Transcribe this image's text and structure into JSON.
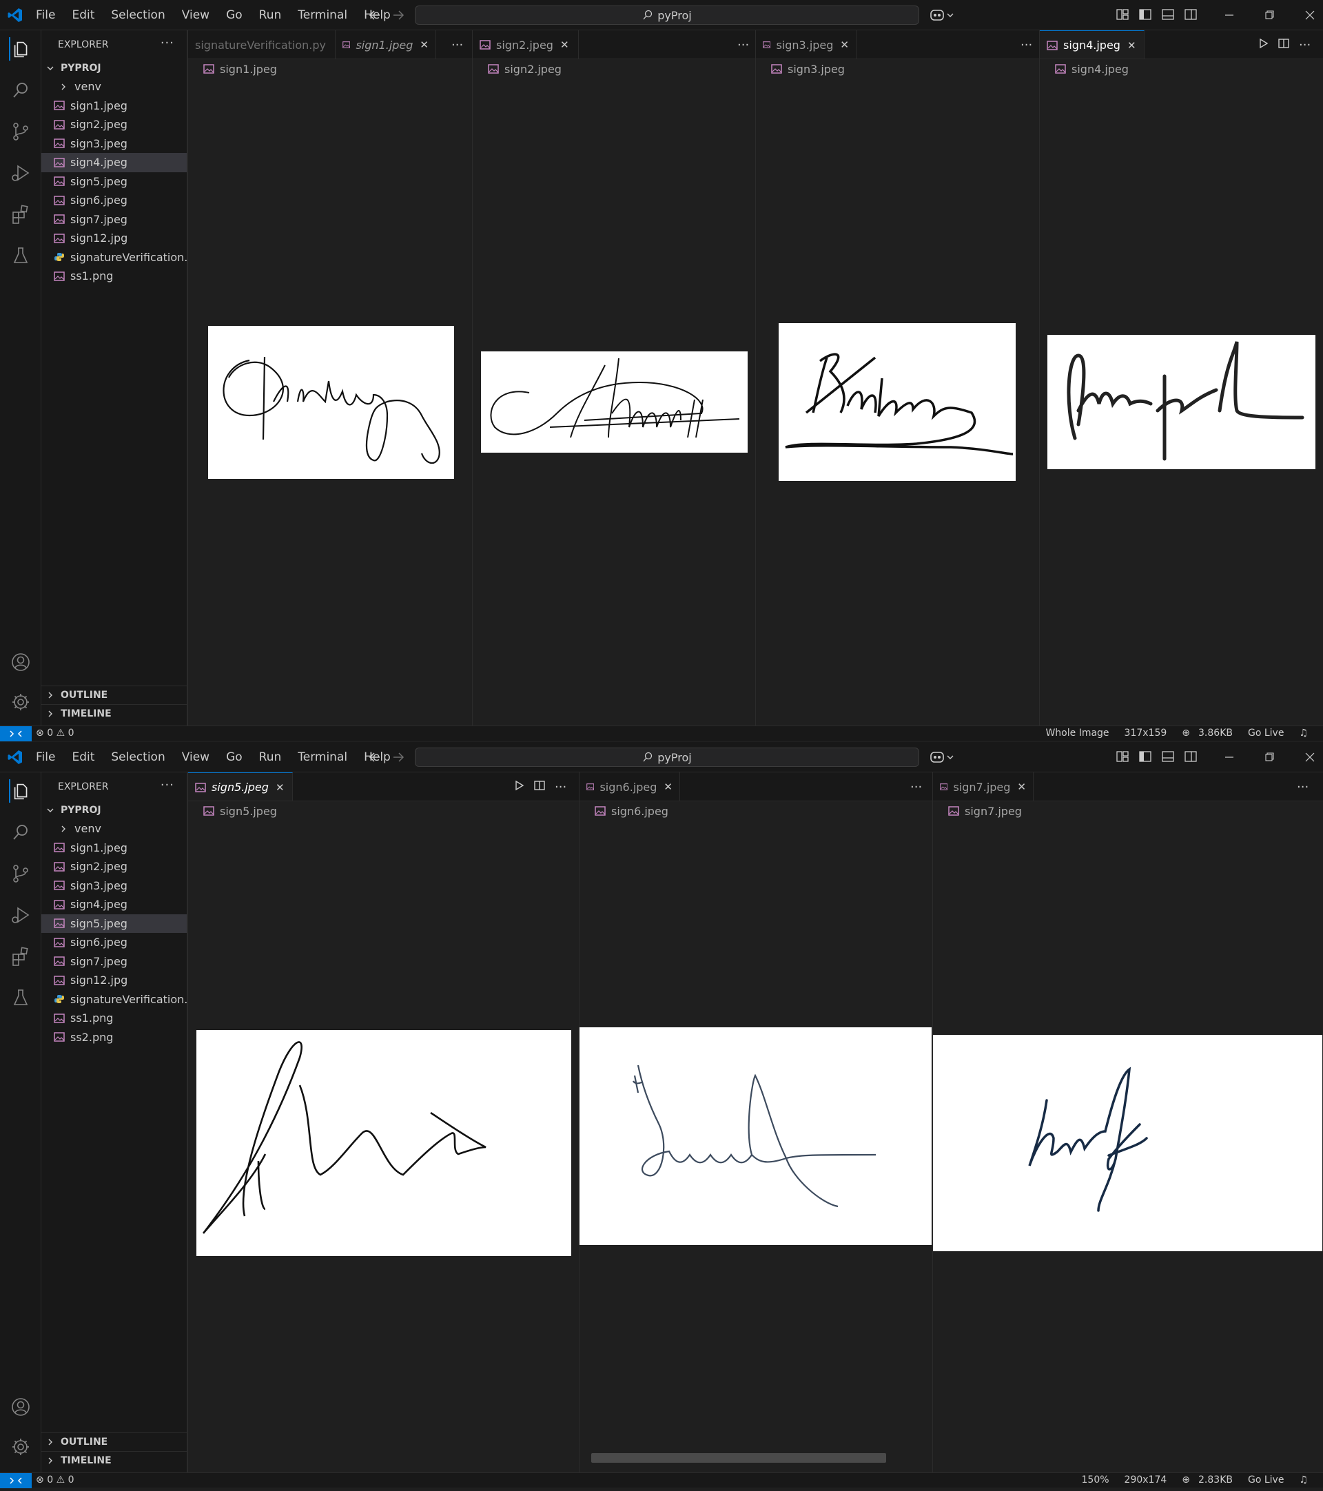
{
  "top_window": {
    "menu": [
      "File",
      "Edit",
      "Selection",
      "View",
      "Go",
      "Run",
      "Terminal",
      "Help"
    ],
    "command_center": "pyProj",
    "explorer": {
      "title": "EXPLORER",
      "project": "PYPROJ",
      "items": [
        {
          "label": "venv",
          "type": "folder"
        },
        {
          "label": "sign1.jpeg",
          "type": "image"
        },
        {
          "label": "sign2.jpeg",
          "type": "image"
        },
        {
          "label": "sign3.jpeg",
          "type": "image"
        },
        {
          "label": "sign4.jpeg",
          "type": "image",
          "selected": true
        },
        {
          "label": "sign5.jpeg",
          "type": "image"
        },
        {
          "label": "sign6.jpeg",
          "type": "image"
        },
        {
          "label": "sign7.jpeg",
          "type": "image"
        },
        {
          "label": "sign12.jpg",
          "type": "image"
        },
        {
          "label": "signatureVerification.py",
          "type": "python"
        },
        {
          "label": "ss1.png",
          "type": "image"
        }
      ],
      "outline": "OUTLINE",
      "timeline": "TIMELINE"
    },
    "panes": [
      {
        "tabs": [
          {
            "label": "signatureVerification.py",
            "state": "inactive"
          },
          {
            "label": "sign1.jpeg",
            "state": "preview"
          }
        ],
        "breadcrumb": "sign1.jpeg"
      },
      {
        "tabs": [
          {
            "label": "sign2.jpeg",
            "state": "inactive"
          }
        ],
        "breadcrumb": "sign2.jpeg"
      },
      {
        "tabs": [
          {
            "label": "sign3.jpeg",
            "state": "inactive"
          }
        ],
        "breadcrumb": "sign3.jpeg"
      },
      {
        "tabs": [
          {
            "label": "sign4.jpeg",
            "state": "active"
          }
        ],
        "breadcrumb": "sign4.jpeg"
      }
    ],
    "status": {
      "errors": "0",
      "warnings": "0",
      "items": [
        "Whole Image",
        "317x159",
        "3.86KB",
        "Go Live"
      ]
    }
  },
  "bottom_window": {
    "menu": [
      "File",
      "Edit",
      "Selection",
      "View",
      "Go",
      "Run",
      "Terminal",
      "Help"
    ],
    "command_center": "pyProj",
    "explorer": {
      "title": "EXPLORER",
      "project": "PYPROJ",
      "items": [
        {
          "label": "venv",
          "type": "folder"
        },
        {
          "label": "sign1.jpeg",
          "type": "image"
        },
        {
          "label": "sign2.jpeg",
          "type": "image"
        },
        {
          "label": "sign3.jpeg",
          "type": "image"
        },
        {
          "label": "sign4.jpeg",
          "type": "image"
        },
        {
          "label": "sign5.jpeg",
          "type": "image",
          "selected": true
        },
        {
          "label": "sign6.jpeg",
          "type": "image"
        },
        {
          "label": "sign7.jpeg",
          "type": "image"
        },
        {
          "label": "sign12.jpg",
          "type": "image"
        },
        {
          "label": "signatureVerification.py",
          "type": "python"
        },
        {
          "label": "ss1.png",
          "type": "image"
        },
        {
          "label": "ss2.png",
          "type": "image"
        }
      ],
      "outline": "OUTLINE",
      "timeline": "TIMELINE"
    },
    "panes": [
      {
        "tabs": [
          {
            "label": "sign5.jpeg",
            "state": "active-preview"
          }
        ],
        "breadcrumb": "sign5.jpeg"
      },
      {
        "tabs": [
          {
            "label": "sign6.jpeg",
            "state": "inactive"
          }
        ],
        "breadcrumb": "sign6.jpeg"
      },
      {
        "tabs": [
          {
            "label": "sign7.jpeg",
            "state": "inactive"
          }
        ],
        "breadcrumb": "sign7.jpeg"
      }
    ],
    "status": {
      "errors": "0",
      "warnings": "0",
      "items": [
        "150%",
        "290x174",
        "2.83KB",
        "Go Live"
      ]
    }
  },
  "colors": {
    "accent": "#0078d4",
    "image_icon": "#c586c0",
    "python_icon": "#3b9ad9"
  }
}
